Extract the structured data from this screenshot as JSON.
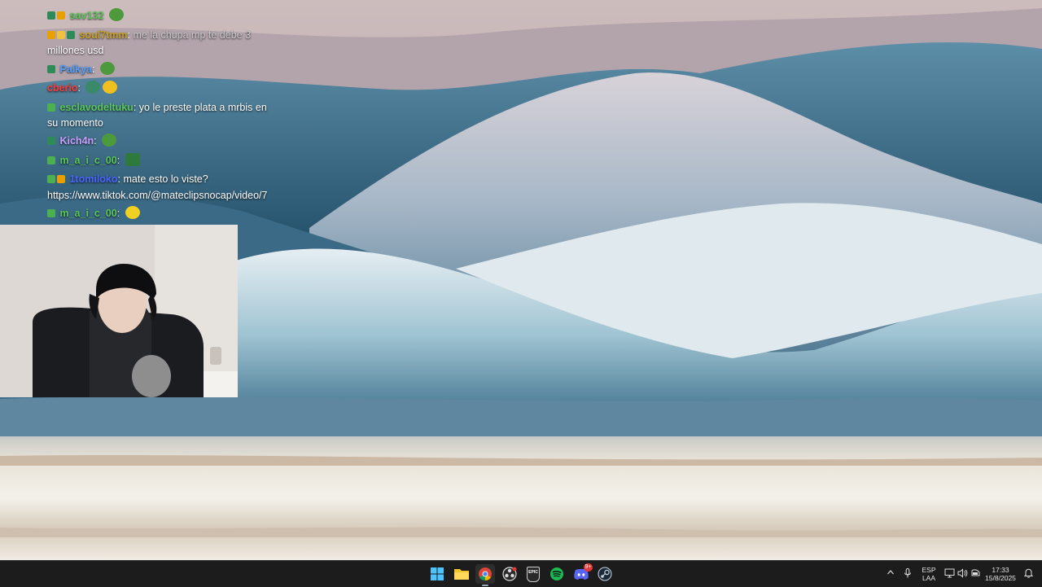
{
  "chat": {
    "lines": [
      {
        "user": "sav132",
        "sep": "",
        "message": "",
        "user_color": "#5ac85a"
      },
      {
        "user": "soul7tmm",
        "sep": ": ",
        "message": "me la chupa mp te debe 3",
        "user_color": "#c8a020"
      },
      {
        "user": "",
        "sep": "",
        "message": "millones usd",
        "user_color": "#ffffff"
      },
      {
        "user": "Palkya",
        "sep": ": ",
        "message": "",
        "user_color": "#4fa0ff"
      },
      {
        "user": "cberio",
        "sep": ": ",
        "message": "",
        "user_color": "#ff3a3a"
      },
      {
        "user": "esclavodeltuku",
        "sep": ": ",
        "message": "yo le preste plata a mrbis en",
        "user_color": "#5ac85a"
      },
      {
        "user": "",
        "sep": "",
        "message": "su momento",
        "user_color": "#ffffff"
      },
      {
        "user": "Kich4n",
        "sep": ": ",
        "message": "",
        "user_color": "#c9a0ff"
      },
      {
        "user": "m_a_i_c_00",
        "sep": ": ",
        "message": "",
        "user_color": "#5ac85a"
      },
      {
        "user": "1tomiloko",
        "sep": ": ",
        "message": "mate esto lo viste?",
        "user_color": "#4a66ff"
      },
      {
        "user": "",
        "sep": "",
        "message": "https://www.tiktok.com/@mateclipsnocap/video/7",
        "user_color": "#ffffff"
      },
      {
        "user": "m_a_i_c_00",
        "sep": ": ",
        "message": "",
        "user_color": "#5ac85a"
      }
    ]
  },
  "taskbar": {
    "apps": [
      {
        "name": "start-button"
      },
      {
        "name": "file-explorer"
      },
      {
        "name": "chrome"
      },
      {
        "name": "obs"
      },
      {
        "name": "epic-games"
      },
      {
        "name": "spotify"
      },
      {
        "name": "discord"
      },
      {
        "name": "steam"
      }
    ],
    "epic_label": "EPIC",
    "discord_badge": "9+",
    "language": "ESP",
    "language_sub": "LAA",
    "time": "17:33",
    "date": "15/8/2025"
  }
}
